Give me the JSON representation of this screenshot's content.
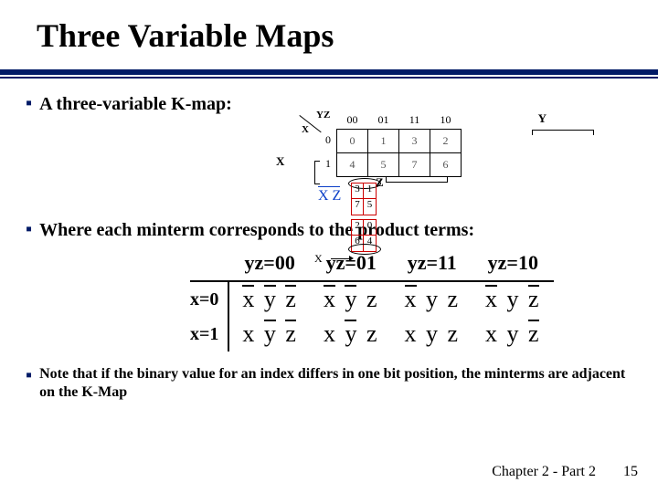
{
  "title": "Three Variable Maps",
  "bullets": {
    "b1": "A three-variable K-map:",
    "b2": "Where each minterm corresponds to the product terms:",
    "b3": "Note that if the binary value for an index differs in one bit position, the minterms are adjacent on the K-Map"
  },
  "kmap": {
    "axis_labels": {
      "Y": "Y",
      "X": "X",
      "Z": "Z",
      "YZ": "YZ"
    },
    "col_headers": [
      "00",
      "01",
      "11",
      "10"
    ],
    "row_headers": [
      "0",
      "1"
    ],
    "cells": [
      [
        "0",
        "1",
        "3",
        "2"
      ],
      [
        "4",
        "5",
        "7",
        "6"
      ]
    ]
  },
  "cylinder": {
    "label_overline": "X Z",
    "cells": [
      "3",
      "1",
      "7",
      "5",
      "2",
      "0",
      "6",
      "4"
    ],
    "arrow_label": "X"
  },
  "minterm_table": {
    "col_headers": [
      "yz=00",
      "yz=01",
      "yz=11",
      "yz=10"
    ],
    "row_headers": [
      "x=0",
      "x=1"
    ],
    "rows": [
      [
        {
          "x_bar": true,
          "y_bar": true,
          "z_bar": true
        },
        {
          "x_bar": true,
          "y_bar": true,
          "z_bar": false
        },
        {
          "x_bar": true,
          "y_bar": false,
          "z_bar": false
        },
        {
          "x_bar": true,
          "y_bar": false,
          "z_bar": true
        }
      ],
      [
        {
          "x_bar": false,
          "y_bar": true,
          "z_bar": true
        },
        {
          "x_bar": false,
          "y_bar": true,
          "z_bar": false
        },
        {
          "x_bar": false,
          "y_bar": false,
          "z_bar": false
        },
        {
          "x_bar": false,
          "y_bar": false,
          "z_bar": true
        }
      ]
    ]
  },
  "footer": {
    "chapter": "Chapter 2 - Part 2",
    "page": "15"
  },
  "letters": {
    "x": "x",
    "y": "y",
    "z": "z"
  }
}
